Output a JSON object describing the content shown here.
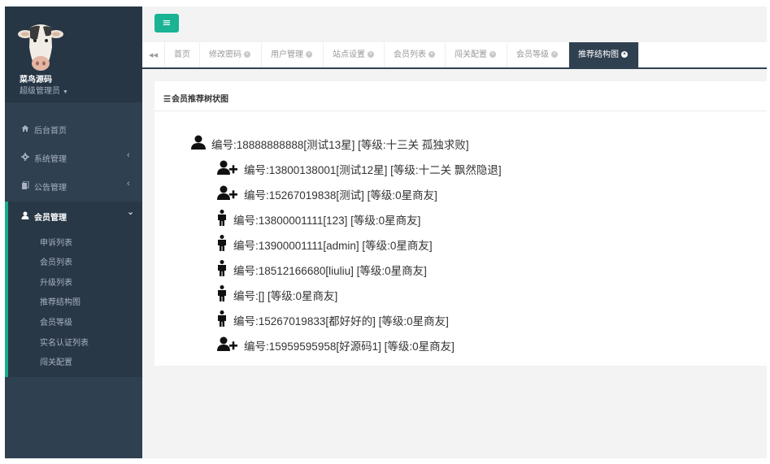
{
  "sidebar": {
    "user": {
      "name": "菜鸟源码",
      "role": "超级管理员"
    },
    "nav": [
      {
        "label": "后台首页",
        "icon": "home-icon",
        "arrow": ""
      },
      {
        "label": "系统管理",
        "icon": "gear-icon",
        "arrow": "‹"
      },
      {
        "label": "公告管理",
        "icon": "copy-icon",
        "arrow": "‹"
      },
      {
        "label": "会员管理",
        "icon": "user-icon",
        "arrow": "⌄"
      }
    ],
    "submenu": [
      "申诉列表",
      "会员列表",
      "升级列表",
      "推荐结构图",
      "会员等级",
      "实名认证列表",
      "闯关配置"
    ]
  },
  "tabs": [
    {
      "label": "首页"
    },
    {
      "label": "修改密码"
    },
    {
      "label": "用户管理"
    },
    {
      "label": "站点设置"
    },
    {
      "label": "会员列表"
    },
    {
      "label": "闯关配置"
    },
    {
      "label": "会员等级"
    },
    {
      "label": "推荐结构图"
    }
  ],
  "panel": {
    "title": "会员推荐树状图"
  },
  "tree": {
    "root": "编号:18888888888[测试13星] [等级:十三关 孤独求败]",
    "children": [
      {
        "text": "编号:13800138001[测试12星] [等级:十二关 飘然隐退]",
        "icon": "user-plus-icon"
      },
      {
        "text": "编号:15267019838[测试] [等级:0星商友]",
        "icon": "user-plus-icon"
      },
      {
        "text": "编号:13800001111[123] [等级:0星商友]",
        "icon": "person-icon"
      },
      {
        "text": "编号:13900001111[admin] [等级:0星商友]",
        "icon": "person-icon"
      },
      {
        "text": "编号:18512166680[liuliu] [等级:0星商友]",
        "icon": "person-icon"
      },
      {
        "text": "编号:[] [等级:0星商友]",
        "icon": "person-icon"
      },
      {
        "text": "编号:15267019833[都好好的] [等级:0星商友]",
        "icon": "person-icon"
      },
      {
        "text": "编号:15959595958[好源码1] [等级:0星商友]",
        "icon": "user-plus-icon"
      }
    ]
  },
  "colors": {
    "sidebar": "#2f4050",
    "sidebar_dark": "#263645",
    "accent": "#1ab394",
    "active_tab": "#2f4050"
  }
}
